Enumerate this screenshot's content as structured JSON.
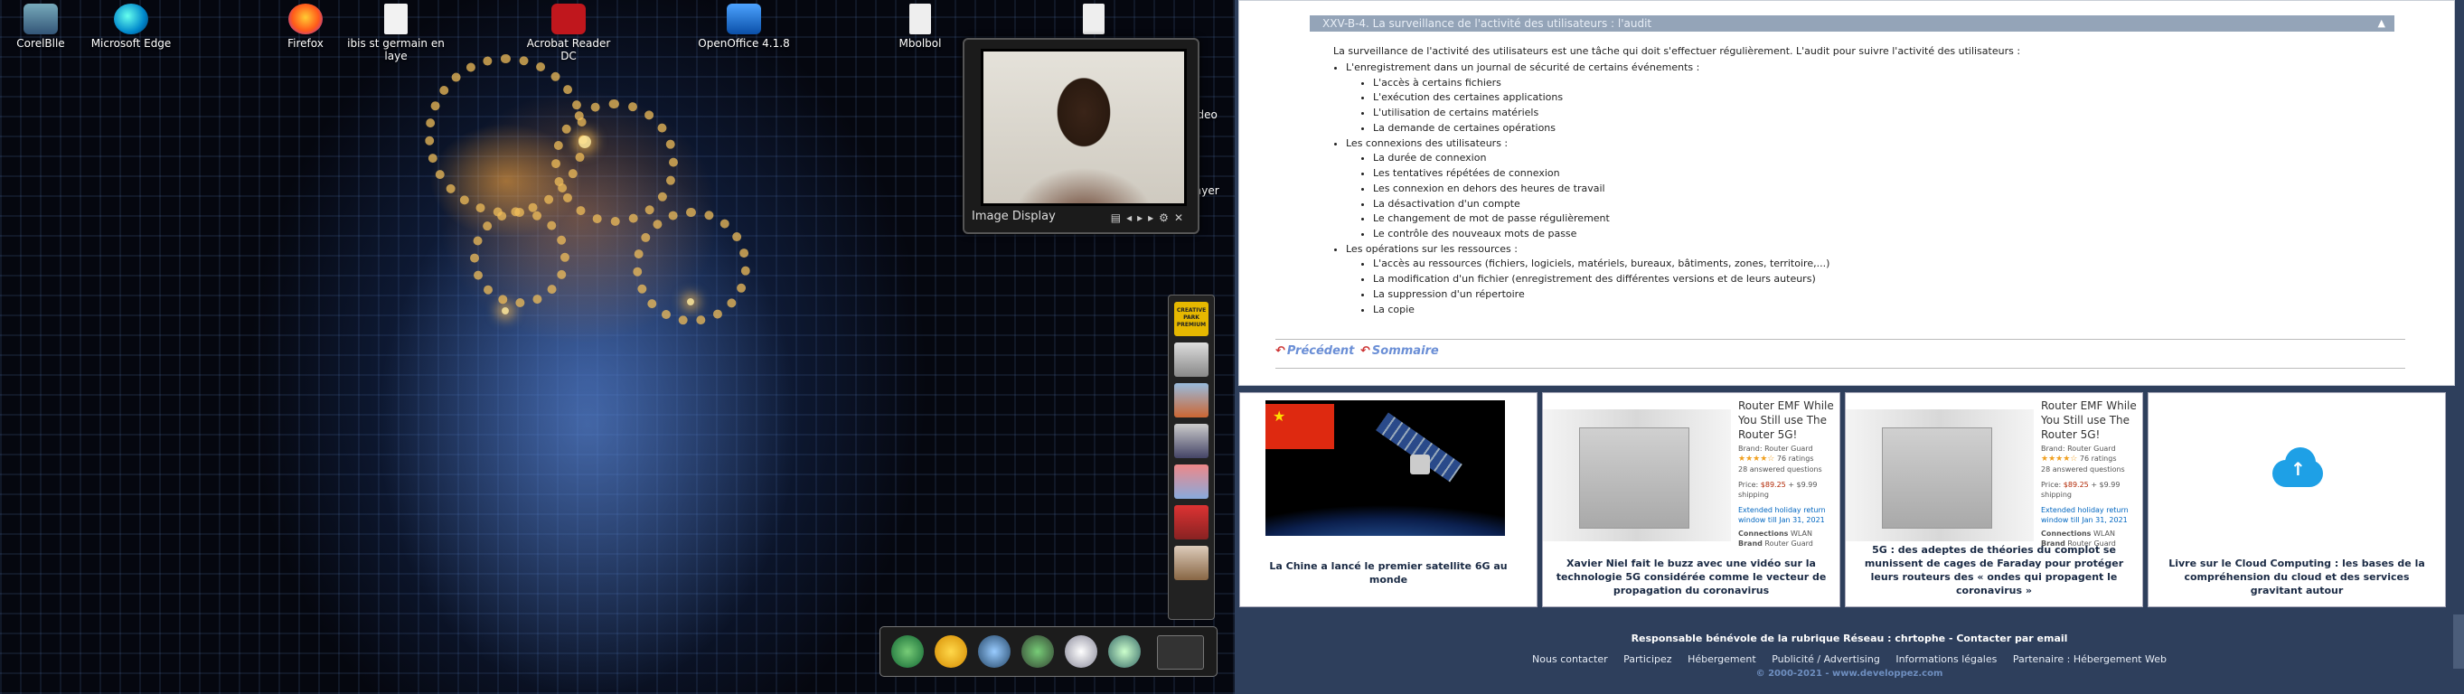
{
  "desktop": {
    "icons": [
      {
        "label": "CorelBlle"
      },
      {
        "label": "Microsoft Edge"
      },
      {
        "label": "Firefox"
      },
      {
        "label": "ibis st germain en laye"
      },
      {
        "label": "Acrobat Reader DC"
      },
      {
        "label": "OpenOffice 4.1.8"
      },
      {
        "label": "Mbolbol"
      },
      {
        "label": "Video"
      },
      {
        "label": "Player"
      }
    ],
    "image_display": {
      "label": "Image Display"
    },
    "dock_badge": "CREATIVE PARK PREMIUM"
  },
  "article": {
    "section_title": "XXV-B-4. La surveillance de l'activité des utilisateurs : l'audit",
    "collapse_glyph": "▲",
    "intro": "La surveillance de l'activité des utilisateurs est une tâche qui doit s'effectuer régulièrement. L'audit pour suivre l'activité des utilisateurs :",
    "groups": [
      {
        "title": "L'enregistrement dans un journal de sécurité de certains événements :",
        "items": [
          "L'accès à certains fichiers",
          "L'exécution des certaines applications",
          "L'utilisation de certains matériels",
          "La demande de certaines opérations"
        ]
      },
      {
        "title": "Les connexions des utilisateurs :",
        "items": [
          "La durée de connexion",
          "Les tentatives répétées de connexion",
          "Les connexion en dehors des heures de travail",
          "La désactivation d'un compte",
          "Le changement de mot de passe régulièrement",
          "Le contrôle des nouveaux mots de passe"
        ]
      },
      {
        "title": "Les opérations sur les ressources :",
        "items": [
          "L'accès au ressources (fichiers, logiciels, matériels, bureaux, bâtiments, zones, territoire,...)",
          "La modification d'un fichier (enregistrement des différentes versions et de leurs auteurs)",
          "La suppression d'un répertoire",
          "La copie"
        ]
      }
    ],
    "nav": {
      "previous": "Précédent",
      "summary": "Sommaire"
    }
  },
  "cards": [
    {
      "caption": "La Chine a lancé le premier satellite 6G au monde"
    },
    {
      "caption": "Xavier Niel fait le buzz avec une vidéo sur la technologie 5G considérée comme le vecteur de propagation du coronavirus",
      "product": {
        "title": "Router EMF While You Still use The Router 5G!",
        "brand": "Brand: Router Guard",
        "ratings": "76 ratings",
        "answered": "28 answered questions",
        "price_label": "Price:",
        "price": "$89.25",
        "shipping": "+ $9.99 shipping",
        "returns": "Extended holiday return window till Jan 31, 2021",
        "connections_label": "Connections",
        "connections": "WLAN",
        "brand_label": "Brand",
        "brand_value": "Router Guard"
      }
    },
    {
      "caption": "5G : des adeptes de théories du complot se munissent de cages de Faraday pour protéger leurs routeurs des « ondes qui propagent le coronavirus »",
      "product": {
        "title": "Router EMF While You Still use The Router 5G!",
        "brand": "Brand: Router Guard",
        "ratings": "76 ratings",
        "answered": "28 answered questions",
        "price_label": "Price:",
        "price": "$89.25",
        "shipping": "+ $9.99 shipping",
        "returns": "Extended holiday return window till Jan 31, 2021",
        "connections_label": "Connections",
        "connections": "WLAN",
        "brand_label": "Brand",
        "brand_value": "Router Guard"
      }
    },
    {
      "caption": "Livre sur le Cloud Computing : les bases de la compréhension du cloud et des services gravitant autour"
    }
  ],
  "footer": {
    "responsible": "Responsable bénévole de la rubrique Réseau : chrtophe - Contacter par email",
    "links": [
      "Nous contacter",
      "Participez",
      "Hébergement",
      "Publicité / Advertising",
      "Informations légales",
      "Partenaire : Hébergement Web"
    ],
    "copyright": "© 2000-2021 - www.developpez.com"
  },
  "colors": {
    "section_bar": "#94a4b8",
    "footer_bg": "#2e3f5c",
    "link": "#6b8fd6"
  }
}
